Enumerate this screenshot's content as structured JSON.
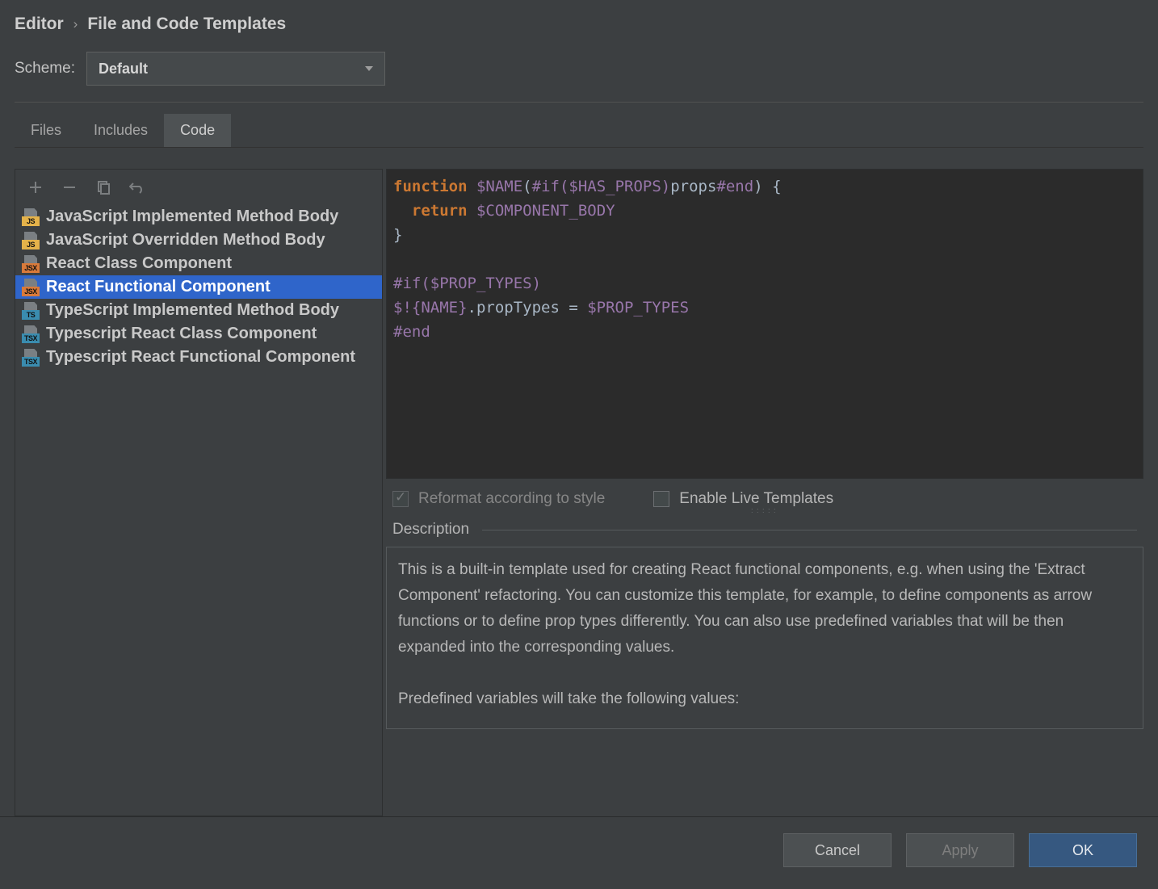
{
  "breadcrumb": {
    "parent": "Editor",
    "current": "File and Code Templates"
  },
  "scheme": {
    "label": "Scheme:",
    "value": "Default"
  },
  "tabs": [
    {
      "label": "Files",
      "active": false
    },
    {
      "label": "Includes",
      "active": false
    },
    {
      "label": "Code",
      "active": true
    }
  ],
  "templates": [
    {
      "icon": "js",
      "label": "JavaScript Implemented Method Body"
    },
    {
      "icon": "js",
      "label": "JavaScript Overridden Method Body"
    },
    {
      "icon": "jsx",
      "label": "React Class Component"
    },
    {
      "icon": "jsx",
      "label": "React Functional Component",
      "selected": true
    },
    {
      "icon": "ts",
      "label": "TypeScript Implemented Method Body"
    },
    {
      "icon": "tsx",
      "label": "Typescript React Class Component"
    },
    {
      "icon": "tsx",
      "label": "Typescript React Functional Component"
    }
  ],
  "code": {
    "line1_kw": "function",
    "line1_var": "$NAME",
    "line1_txt1": "(",
    "line1_dir1": "#if($HAS_PROPS)",
    "line1_txt2": "props",
    "line1_dir2": "#end",
    "line1_txt3": ") {",
    "line2_kw": "return",
    "line2_var": "$COMPONENT_BODY",
    "line3": "}",
    "line5": "#if($PROP_TYPES)",
    "line6_a": "$!{NAME}",
    "line6_b": ".propTypes = ",
    "line6_c": "$PROP_TYPES",
    "line7": "#end"
  },
  "options": {
    "reformat": "Reformat according to style",
    "liveTemplates": "Enable Live Templates"
  },
  "description": {
    "title": "Description",
    "body": "This is a built-in template used for creating React functional components, e.g. when using the 'Extract Component' refactoring. You can customize this template, for example, to define components as arrow functions or to define prop types differently. You can also use predefined variables that will be then expanded into the corresponding values.",
    "body2": "Predefined variables will take the following values:"
  },
  "buttons": {
    "cancel": "Cancel",
    "apply": "Apply",
    "ok": "OK"
  }
}
